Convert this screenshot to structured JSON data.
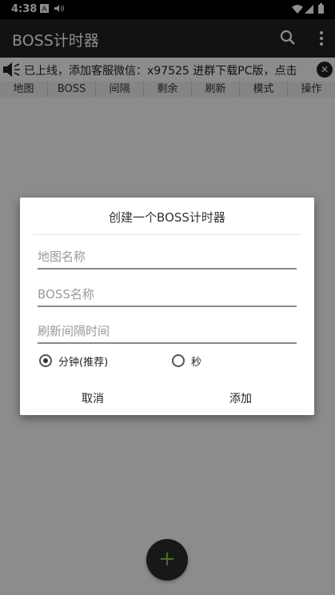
{
  "status": {
    "time": "4:38",
    "left_icons": [
      "a-icon",
      "sound-icon"
    ],
    "right_icons": [
      "wifi-icon",
      "signal-icon",
      "battery-icon"
    ]
  },
  "appbar": {
    "title": "BOSS计时器",
    "search_icon": "search-icon",
    "menu_icon": "more-vert-icon"
  },
  "marquee": {
    "text": "已上线，添加客服微信：x97525 进群下载PC版，点击",
    "close": "✕"
  },
  "tabs": [
    "地图",
    "BOSS",
    "间隔",
    "剩余",
    "刷新",
    "模式",
    "操作"
  ],
  "dialog": {
    "title": "创建一个BOSS计时器",
    "map_placeholder": "地图名称",
    "boss_placeholder": "BOSS名称",
    "interval_placeholder": "刷新间隔时间",
    "unit_minutes": "分钟(推荐)",
    "unit_seconds": "秒",
    "cancel": "取消",
    "add": "添加"
  },
  "fab": "+",
  "colors": {
    "appbar": "#212121",
    "fab_plus": "#8bc34a",
    "scrim": "#000000"
  }
}
